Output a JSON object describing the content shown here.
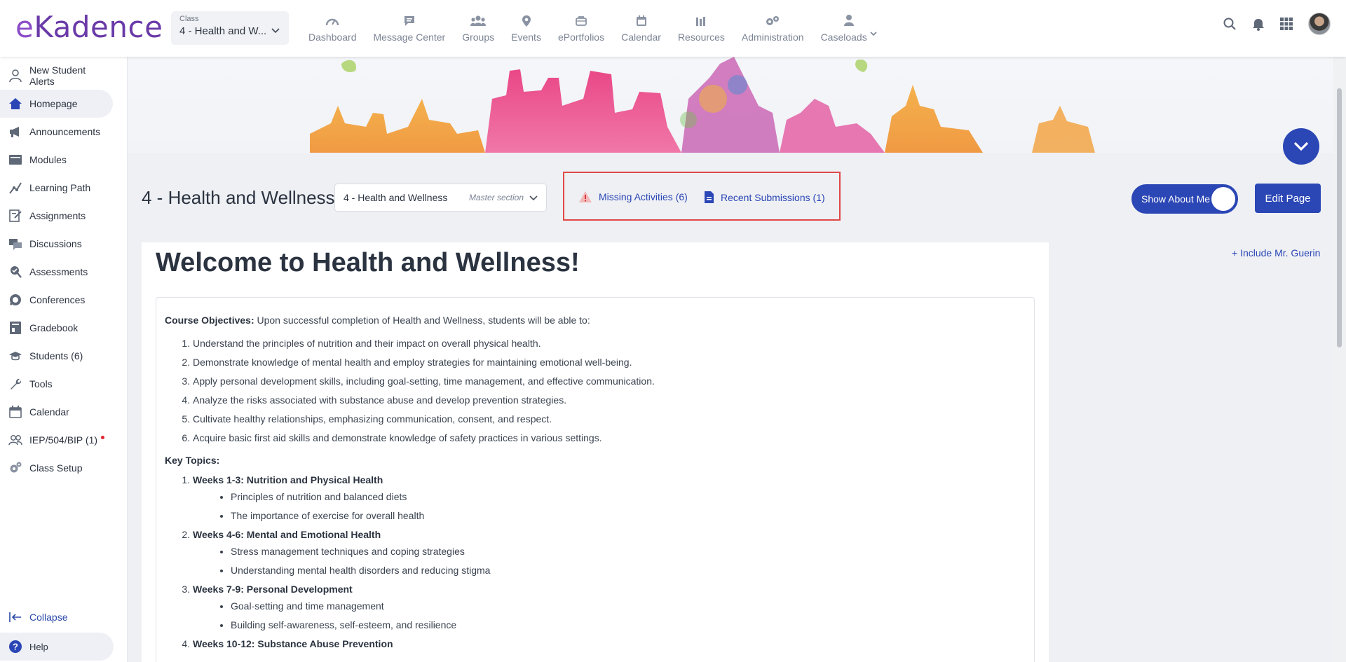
{
  "app": {
    "logo_e": "e",
    "logo_rest": "Kadence"
  },
  "class_select": {
    "label": "Class",
    "value": "4 - Health and W..."
  },
  "nav": [
    {
      "label": "Dashboard",
      "icon": "dashboard-icon"
    },
    {
      "label": "Message Center",
      "icon": "message-icon"
    },
    {
      "label": "Groups",
      "icon": "groups-icon"
    },
    {
      "label": "Events",
      "icon": "location-pin-icon"
    },
    {
      "label": "ePortfolios",
      "icon": "briefcase-icon"
    },
    {
      "label": "Calendar",
      "icon": "calendar-icon"
    },
    {
      "label": "Resources",
      "icon": "resources-icon"
    },
    {
      "label": "Administration",
      "icon": "gears-icon"
    },
    {
      "label": "Caseloads",
      "icon": "person-icon"
    }
  ],
  "sidebar": {
    "items": [
      {
        "label": "New Student Alerts"
      },
      {
        "label": "Homepage"
      },
      {
        "label": "Announcements"
      },
      {
        "label": "Modules"
      },
      {
        "label": "Learning Path"
      },
      {
        "label": "Assignments"
      },
      {
        "label": "Discussions"
      },
      {
        "label": "Assessments"
      },
      {
        "label": "Conferences"
      },
      {
        "label": "Gradebook"
      },
      {
        "label": "Students (6)"
      },
      {
        "label": "Tools"
      },
      {
        "label": "Calendar"
      },
      {
        "label": "IEP/504/BIP (1)"
      },
      {
        "label": "Class Setup"
      }
    ],
    "collapse": "Collapse",
    "help": "Help"
  },
  "header": {
    "course_title": "4 - Health and Wellness",
    "section_value": "4 - Health and Wellness",
    "section_hint": "Master section",
    "missing": "Missing Activities (6)",
    "recent": "Recent Submissions (1)",
    "about_me": "Show About Me",
    "edit_page": "Edit Page",
    "include": "+ Include Mr. Guerin"
  },
  "content": {
    "welcome": "Welcome to Health and Wellness!",
    "objectives_label": "Course Objectives:",
    "objectives_intro": " Upon successful completion of Health and Wellness, students will be able to:",
    "objectives": [
      "Understand the principles of nutrition and their impact on overall physical health.",
      "Demonstrate knowledge of mental health and employ strategies for maintaining emotional well-being.",
      "Apply personal development skills, including goal-setting, time management, and effective communication.",
      "Analyze the risks associated with substance abuse and develop prevention strategies.",
      "Cultivate healthy relationships, emphasizing communication, consent, and respect.",
      "Acquire basic first aid skills and demonstrate knowledge of safety practices in various settings."
    ],
    "key_topics": "Key Topics:",
    "topics": [
      {
        "title": "Weeks 1-3: Nutrition and Physical Health",
        "items": [
          "Principles of nutrition and balanced diets",
          "The importance of exercise for overall health"
        ]
      },
      {
        "title": "Weeks 4-6: Mental and Emotional Health",
        "items": [
          "Stress management techniques and coping strategies",
          "Understanding mental health disorders and reducing stigma"
        ]
      },
      {
        "title": "Weeks 7-9: Personal Development",
        "items": [
          "Goal-setting and time management",
          "Building self-awareness, self-esteem, and resilience"
        ]
      },
      {
        "title": "Weeks 10-12: Substance Abuse Prevention",
        "items": []
      }
    ]
  },
  "colors": {
    "brand": "#6a3aa8",
    "accent": "#2b46b5",
    "alert_border": "#e04848"
  }
}
